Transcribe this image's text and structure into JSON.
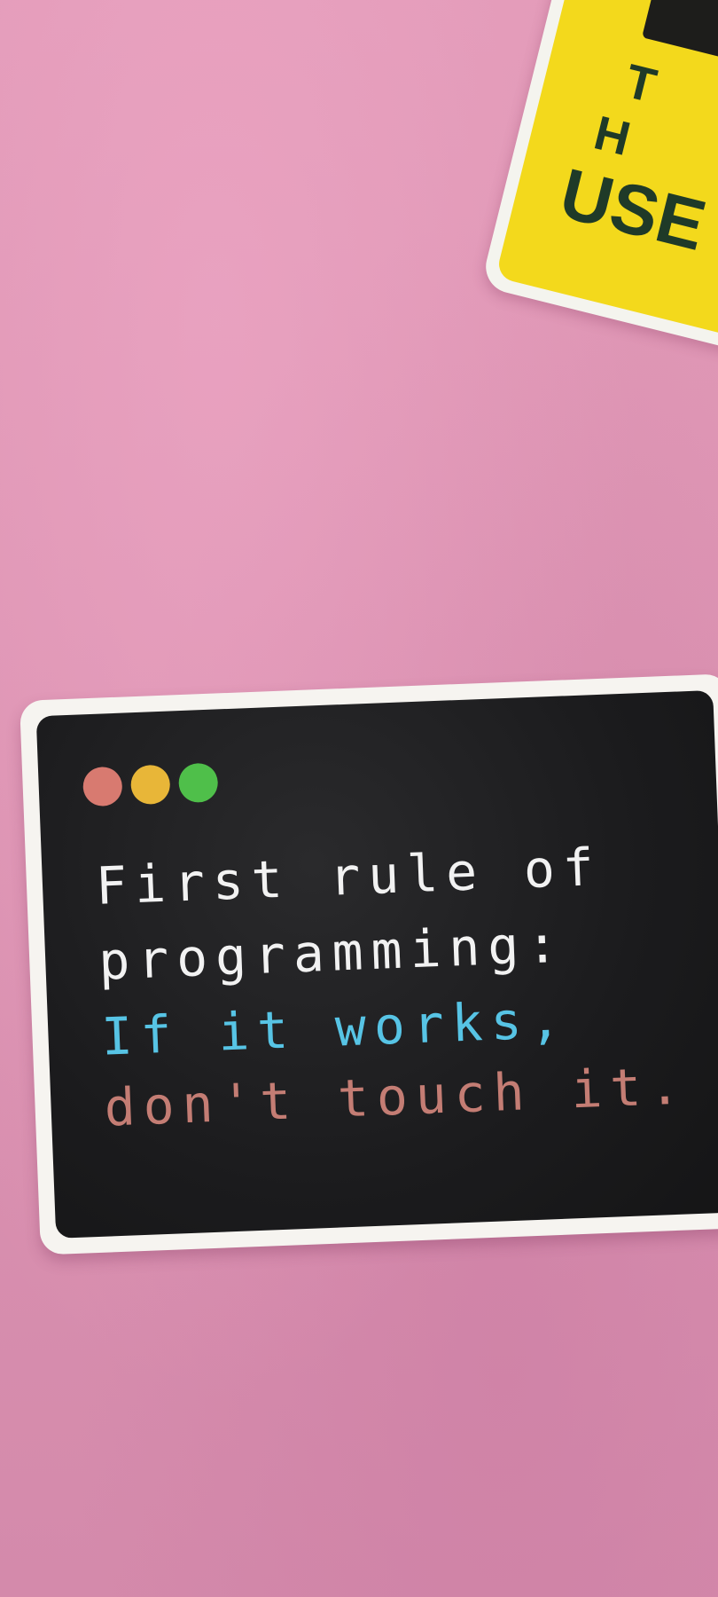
{
  "photo": {
    "background_color": "#dc93b2"
  },
  "yellow_sticker": {
    "visible_text": [
      "T",
      "H",
      "USE"
    ],
    "colors": {
      "fill": "#f3d91c",
      "text": "#1f3a28",
      "border": "#f4f4ee"
    }
  },
  "terminal_sticker": {
    "window_dots": [
      {
        "name": "red-dot",
        "color": "#d87a70"
      },
      {
        "name": "yellow-dot",
        "color": "#e8b638"
      },
      {
        "name": "green-dot",
        "color": "#4fbf4a"
      }
    ],
    "lines": [
      {
        "text": "First rule of",
        "color": "#f2f2f2"
      },
      {
        "text": "programming:",
        "color": "#f2f2f2"
      },
      {
        "text": "If it works,",
        "color": "#57c4e5"
      },
      {
        "text": "don't touch it.",
        "color": "#c47d74"
      }
    ]
  }
}
